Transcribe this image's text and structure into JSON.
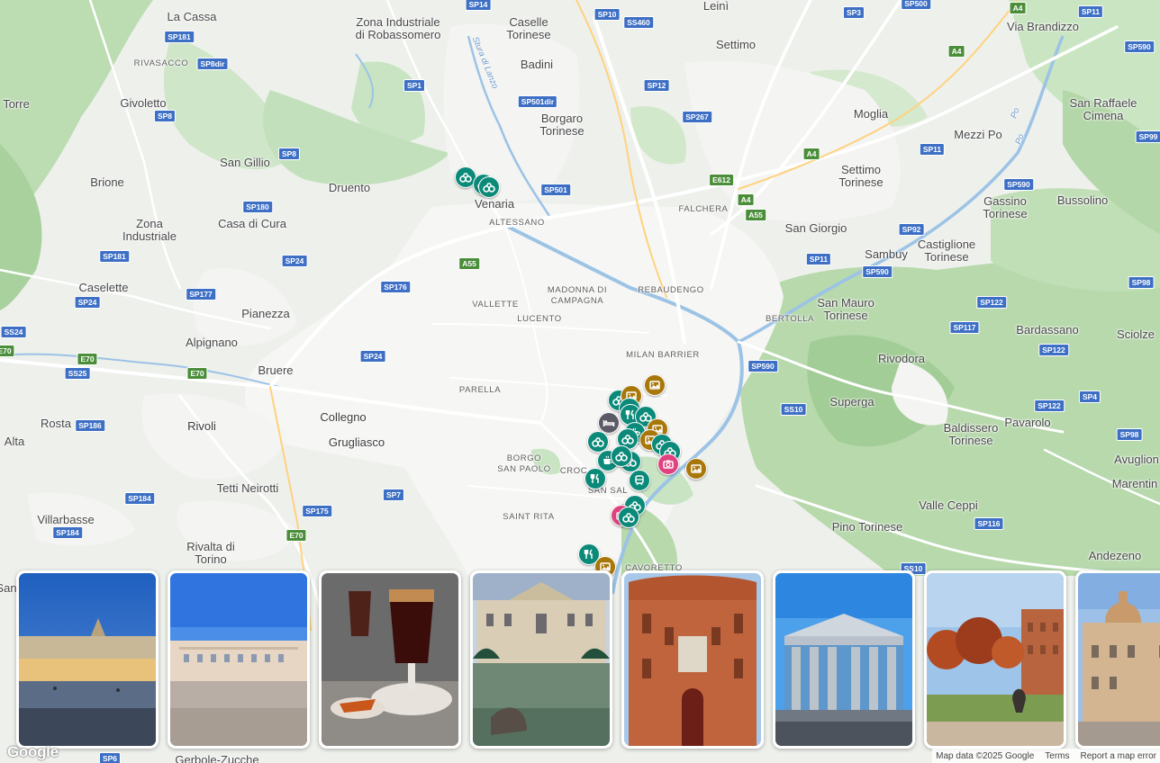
{
  "map": {
    "colors": {
      "water": "#9cc3e6",
      "park": "#c8e4c2",
      "forest": "#b1d5a6",
      "urban": "#f6f6f4",
      "road": "#ffffff",
      "highway": "#ffd27f",
      "land": "#eef0ec"
    },
    "places": [
      {
        "id": "la-cassa",
        "name": "La Cassa",
        "kind": "town"
      },
      {
        "id": "zona-industriale-robassomero",
        "name": "Zona Industriale\ndi Robassomero",
        "kind": "town"
      },
      {
        "id": "caselle-torinese",
        "name": "Caselle\nTorinese",
        "kind": "town"
      },
      {
        "id": "leini",
        "name": "Leinì",
        "kind": "town"
      },
      {
        "id": "via-brandizzo",
        "name": "Via Brandizzo",
        "kind": "town"
      },
      {
        "id": "torre",
        "name": "Torre",
        "kind": "town"
      },
      {
        "id": "givoletto",
        "name": "Givoletto",
        "kind": "town"
      },
      {
        "id": "rivasacco",
        "name": "RIVASACCO",
        "kind": "hood"
      },
      {
        "id": "badini",
        "name": "Badini",
        "kind": "town"
      },
      {
        "id": "settimo",
        "name": "Settimo",
        "kind": "town"
      },
      {
        "id": "borgaro-torinese",
        "name": "Borgaro\nTorinese",
        "kind": "town"
      },
      {
        "id": "moglia",
        "name": "Moglia",
        "kind": "town"
      },
      {
        "id": "san-raffaele-cimena",
        "name": "San Raffaele\nCimena",
        "kind": "town"
      },
      {
        "id": "mezzi-po",
        "name": "Mezzi Po",
        "kind": "town"
      },
      {
        "id": "san-gillio",
        "name": "San Gillio",
        "kind": "town"
      },
      {
        "id": "brione",
        "name": "Brione",
        "kind": "town"
      },
      {
        "id": "druento",
        "name": "Druento",
        "kind": "town"
      },
      {
        "id": "venaria",
        "name": "Venaria",
        "kind": "town"
      },
      {
        "id": "settimo-torinese",
        "name": "Settimo\nTorinese",
        "kind": "town"
      },
      {
        "id": "gassino-torinese",
        "name": "Gassino\nTorinese",
        "kind": "town"
      },
      {
        "id": "bussolino",
        "name": "Bussolino",
        "kind": "town"
      },
      {
        "id": "falchera",
        "name": "FALCHERA",
        "kind": "hood"
      },
      {
        "id": "altessano",
        "name": "ALTESSANO",
        "kind": "hood"
      },
      {
        "id": "zona-industriale",
        "name": "Zona\nIndustriale",
        "kind": "town"
      },
      {
        "id": "casa-di-cura",
        "name": "Casa di Cura",
        "kind": "town"
      },
      {
        "id": "san-giorgio",
        "name": "San Giorgio",
        "kind": "town"
      },
      {
        "id": "sambuy",
        "name": "Sambuy",
        "kind": "town"
      },
      {
        "id": "castiglione-torinese",
        "name": "Castiglione\nTorinese",
        "kind": "town"
      },
      {
        "id": "caselette",
        "name": "Caselette",
        "kind": "town"
      },
      {
        "id": "pianezza",
        "name": "Pianezza",
        "kind": "town"
      },
      {
        "id": "madonna-di-campagna",
        "name": "MADONNA DI\nCAMPAGNA",
        "kind": "hood"
      },
      {
        "id": "rebaudengo",
        "name": "REBAUDENGO",
        "kind": "hood"
      },
      {
        "id": "vallette",
        "name": "VALLETTE",
        "kind": "hood"
      },
      {
        "id": "lucento",
        "name": "LUCENTO",
        "kind": "hood"
      },
      {
        "id": "bertolla",
        "name": "BERTOLLA",
        "kind": "hood"
      },
      {
        "id": "san-mauro-torinese",
        "name": "San Mauro\nTorinese",
        "kind": "town"
      },
      {
        "id": "bardassano",
        "name": "Bardassano",
        "kind": "town"
      },
      {
        "id": "sciolze",
        "name": "Sciolze",
        "kind": "town"
      },
      {
        "id": "alpignano",
        "name": "Alpignano",
        "kind": "town"
      },
      {
        "id": "milan-barrier",
        "name": "MILAN BARRIER",
        "kind": "hood"
      },
      {
        "id": "rivodora",
        "name": "Rivodora",
        "kind": "town"
      },
      {
        "id": "bruere",
        "name": "Bruere",
        "kind": "town"
      },
      {
        "id": "parella",
        "name": "PARELLA",
        "kind": "hood"
      },
      {
        "id": "superga",
        "name": "Superga",
        "kind": "town"
      },
      {
        "id": "collegno",
        "name": "Collegno",
        "kind": "city"
      },
      {
        "id": "rosta",
        "name": "Rosta",
        "kind": "town"
      },
      {
        "id": "rivoli",
        "name": "Rivoli",
        "kind": "city"
      },
      {
        "id": "baldissero-torinese",
        "name": "Baldissero\nTorinese",
        "kind": "town"
      },
      {
        "id": "pavarolo",
        "name": "Pavarolo",
        "kind": "town"
      },
      {
        "id": "alta",
        "name": "Alta",
        "kind": "town"
      },
      {
        "id": "grugliasco",
        "name": "Grugliasco",
        "kind": "city"
      },
      {
        "id": "borgo-san-paolo",
        "name": "BORGO\nSAN PAOLO",
        "kind": "hood"
      },
      {
        "id": "crocetta",
        "name": "CROC",
        "kind": "hood"
      },
      {
        "id": "avuglione",
        "name": "Avuglion",
        "kind": "town"
      },
      {
        "id": "tetti-neirotti",
        "name": "Tetti Neirotti",
        "kind": "town"
      },
      {
        "id": "san-salvario",
        "name": "SAN SAL",
        "kind": "hood"
      },
      {
        "id": "marentino",
        "name": "Marentin",
        "kind": "town"
      },
      {
        "id": "valle-ceppi",
        "name": "Valle Ceppi",
        "kind": "town"
      },
      {
        "id": "villarbasse",
        "name": "Villarbasse",
        "kind": "town"
      },
      {
        "id": "saint-rita",
        "name": "SAINT RITA",
        "kind": "hood"
      },
      {
        "id": "pino-torinese",
        "name": "Pino Torinese",
        "kind": "town"
      },
      {
        "id": "rivalta-di-torino",
        "name": "Rivalta di\nTorino",
        "kind": "town"
      },
      {
        "id": "andezeno",
        "name": "Andezeno",
        "kind": "town"
      },
      {
        "id": "cavoretto",
        "name": "CAVORETTO",
        "kind": "hood"
      },
      {
        "id": "san",
        "name": "San",
        "kind": "town"
      },
      {
        "id": "gerbole-zucche",
        "name": "Gerbole-Zucche",
        "kind": "town"
      },
      {
        "id": "stura-di-lanzo",
        "name": "Stura di Lanzo",
        "kind": "water"
      },
      {
        "id": "po-river",
        "name": "Po",
        "kind": "water"
      },
      {
        "id": "po-river-2",
        "name": "Po",
        "kind": "water"
      }
    ],
    "roads": [
      {
        "id": "sp14",
        "ref": "SP14",
        "kind": "blue"
      },
      {
        "id": "sp500",
        "ref": "SP500",
        "kind": "blue"
      },
      {
        "id": "sp11-top",
        "ref": "SP11",
        "kind": "blue"
      },
      {
        "id": "a4-top",
        "ref": "A4",
        "kind": "green"
      },
      {
        "id": "sp10",
        "ref": "SP10",
        "kind": "blue"
      },
      {
        "id": "ss460",
        "ref": "SS460",
        "kind": "blue"
      },
      {
        "id": "sp3",
        "ref": "SP3",
        "kind": "blue"
      },
      {
        "id": "sp181-top",
        "ref": "SP181",
        "kind": "blue"
      },
      {
        "id": "sp8dir",
        "ref": "SP8dir",
        "kind": "blue"
      },
      {
        "id": "a4-mid",
        "ref": "A4",
        "kind": "green"
      },
      {
        "id": "sp590-top",
        "ref": "SP590",
        "kind": "blue"
      },
      {
        "id": "sp1",
        "ref": "SP1",
        "kind": "blue"
      },
      {
        "id": "sp12",
        "ref": "SP12",
        "kind": "blue"
      },
      {
        "id": "sp501dir",
        "ref": "SP501dir",
        "kind": "blue"
      },
      {
        "id": "sp8-a",
        "ref": "SP8",
        "kind": "blue"
      },
      {
        "id": "sp267",
        "ref": "SP267",
        "kind": "blue"
      },
      {
        "id": "sp99",
        "ref": "SP99",
        "kind": "blue"
      },
      {
        "id": "sp11-mid",
        "ref": "SP11",
        "kind": "blue"
      },
      {
        "id": "sp8-b",
        "ref": "SP8",
        "kind": "blue"
      },
      {
        "id": "a4-low",
        "ref": "A4",
        "kind": "green"
      },
      {
        "id": "e612",
        "ref": "E612",
        "kind": "green"
      },
      {
        "id": "sp590-mid",
        "ref": "SP590",
        "kind": "blue"
      },
      {
        "id": "sp501",
        "ref": "SP501",
        "kind": "blue"
      },
      {
        "id": "a4-b",
        "ref": "A4",
        "kind": "green"
      },
      {
        "id": "sp180",
        "ref": "SP180",
        "kind": "blue"
      },
      {
        "id": "a55-a",
        "ref": "A55",
        "kind": "green"
      },
      {
        "id": "sp92",
        "ref": "SP92",
        "kind": "blue"
      },
      {
        "id": "sp181-mid",
        "ref": "SP181",
        "kind": "blue"
      },
      {
        "id": "sp24-a",
        "ref": "SP24",
        "kind": "blue"
      },
      {
        "id": "sp11-low",
        "ref": "SP11",
        "kind": "blue"
      },
      {
        "id": "a55-b",
        "ref": "A55",
        "kind": "green"
      },
      {
        "id": "sp590-low",
        "ref": "SP590",
        "kind": "blue"
      },
      {
        "id": "sp98-a",
        "ref": "SP98",
        "kind": "blue"
      },
      {
        "id": "sp176",
        "ref": "SP176",
        "kind": "blue"
      },
      {
        "id": "sp177",
        "ref": "SP177",
        "kind": "blue"
      },
      {
        "id": "sp24-b",
        "ref": "SP24",
        "kind": "blue"
      },
      {
        "id": "sp122-a",
        "ref": "SP122",
        "kind": "blue"
      },
      {
        "id": "ss24",
        "ref": "SS24",
        "kind": "blue"
      },
      {
        "id": "sp117",
        "ref": "SP117",
        "kind": "blue"
      },
      {
        "id": "e70-a",
        "ref": "E70",
        "kind": "green"
      },
      {
        "id": "sp122-b",
        "ref": "SP122",
        "kind": "blue"
      },
      {
        "id": "e70-b",
        "ref": "E70",
        "kind": "green"
      },
      {
        "id": "sp24-c",
        "ref": "SP24",
        "kind": "blue"
      },
      {
        "id": "ss25",
        "ref": "SS25",
        "kind": "blue"
      },
      {
        "id": "e70-c",
        "ref": "E70",
        "kind": "green"
      },
      {
        "id": "sp590-river",
        "ref": "SP590",
        "kind": "blue"
      },
      {
        "id": "ss10-a",
        "ref": "SS10",
        "kind": "blue"
      },
      {
        "id": "sp4",
        "ref": "SP4",
        "kind": "blue"
      },
      {
        "id": "sp122-c",
        "ref": "SP122",
        "kind": "blue"
      },
      {
        "id": "sp186",
        "ref": "SP186",
        "kind": "blue"
      },
      {
        "id": "sp98-b",
        "ref": "SP98",
        "kind": "blue"
      },
      {
        "id": "sp7",
        "ref": "SP7",
        "kind": "blue"
      },
      {
        "id": "sp184-a",
        "ref": "SP184",
        "kind": "blue"
      },
      {
        "id": "sp175",
        "ref": "SP175",
        "kind": "blue"
      },
      {
        "id": "sp184-b",
        "ref": "SP184",
        "kind": "blue"
      },
      {
        "id": "sp116",
        "ref": "SP116",
        "kind": "blue"
      },
      {
        "id": "e70-d",
        "ref": "E70",
        "kind": "green"
      },
      {
        "id": "ss10-b",
        "ref": "SS10",
        "kind": "blue"
      },
      {
        "id": "sp6",
        "ref": "SP6",
        "kind": "blue"
      }
    ],
    "pins": [
      {
        "id": "p1",
        "category": "museum",
        "icon": "binoculars-icon",
        "color": "#0b8a7a"
      },
      {
        "id": "p2",
        "category": "museum",
        "icon": "binoculars-icon",
        "color": "#0b8a7a"
      },
      {
        "id": "p3",
        "category": "museum",
        "icon": "binoculars-icon",
        "color": "#0b8a7a"
      },
      {
        "id": "p4",
        "category": "art",
        "icon": "picture-icon",
        "color": "#a8770a"
      },
      {
        "id": "p5",
        "category": "museum",
        "icon": "binoculars-icon",
        "color": "#0b8a7a"
      },
      {
        "id": "p6",
        "category": "art",
        "icon": "picture-icon",
        "color": "#a8770a"
      },
      {
        "id": "p7",
        "category": "museum",
        "icon": "binoculars-icon",
        "color": "#0b8a7a"
      },
      {
        "id": "p8",
        "category": "food",
        "icon": "restaurant-icon",
        "color": "#0b8a7a"
      },
      {
        "id": "p9",
        "category": "museum",
        "icon": "binoculars-icon",
        "color": "#0b8a7a"
      },
      {
        "id": "p10",
        "category": "hotel",
        "icon": "bed-icon",
        "color": "#5c5a66"
      },
      {
        "id": "p11",
        "category": "art",
        "icon": "picture-icon",
        "color": "#a8770a"
      },
      {
        "id": "p12",
        "category": "cafe",
        "icon": "coffee-icon",
        "color": "#0b8a7a"
      },
      {
        "id": "p13",
        "category": "museum",
        "icon": "binoculars-icon",
        "color": "#0b8a7a"
      },
      {
        "id": "p14",
        "category": "art",
        "icon": "picture-icon",
        "color": "#a8770a"
      },
      {
        "id": "p15",
        "category": "museum",
        "icon": "binoculars-icon",
        "color": "#0b8a7a"
      },
      {
        "id": "p16",
        "category": "museum",
        "icon": "binoculars-icon",
        "color": "#0b8a7a"
      },
      {
        "id": "p17",
        "category": "museum",
        "icon": "binoculars-icon",
        "color": "#0b8a7a"
      },
      {
        "id": "p18",
        "category": "museum",
        "icon": "binoculars-icon",
        "color": "#0b8a7a"
      },
      {
        "id": "p19",
        "category": "cafe",
        "icon": "coffee-icon",
        "color": "#0b8a7a"
      },
      {
        "id": "p20",
        "category": "museum",
        "icon": "binoculars-icon",
        "color": "#0b8a7a"
      },
      {
        "id": "p21",
        "category": "shopping",
        "icon": "camera-icon",
        "color": "#e0427f"
      },
      {
        "id": "p22",
        "category": "art",
        "icon": "picture-icon",
        "color": "#a8770a"
      },
      {
        "id": "p23",
        "category": "food",
        "icon": "restaurant-icon",
        "color": "#0b8a7a"
      },
      {
        "id": "p24",
        "category": "transit",
        "icon": "train-icon",
        "color": "#0b8a7a"
      },
      {
        "id": "p25",
        "category": "museum",
        "icon": "binoculars-icon",
        "color": "#0b8a7a"
      },
      {
        "id": "p26",
        "category": "shopping",
        "icon": "camera-icon",
        "color": "#e0427f"
      },
      {
        "id": "p27",
        "category": "museum",
        "icon": "binoculars-icon",
        "color": "#0b8a7a"
      },
      {
        "id": "p28",
        "category": "food",
        "icon": "restaurant-icon",
        "color": "#0b8a7a"
      },
      {
        "id": "p29",
        "category": "art",
        "icon": "picture-icon",
        "color": "#a8770a"
      }
    ]
  },
  "photo_cards": [
    {
      "id": "piazza-castello",
      "scene": "plaza-dusk"
    },
    {
      "id": "palazzo-reale",
      "scene": "palace-square"
    },
    {
      "id": "bicerin-cafe",
      "scene": "coffee-drink"
    },
    {
      "id": "venaria-reale",
      "scene": "palace-fountain"
    },
    {
      "id": "palazzo-carignano",
      "scene": "brick-baroque"
    },
    {
      "id": "gran-madre",
      "scene": "neoclassical-temple"
    },
    {
      "id": "giardini-reali",
      "scene": "autumn-garden"
    },
    {
      "id": "cathedral-dome",
      "scene": "dome-building"
    }
  ],
  "footer": {
    "logo": "Google",
    "map_data": "Map data ©2025 Google",
    "terms": "Terms",
    "report": "Report a map error"
  }
}
